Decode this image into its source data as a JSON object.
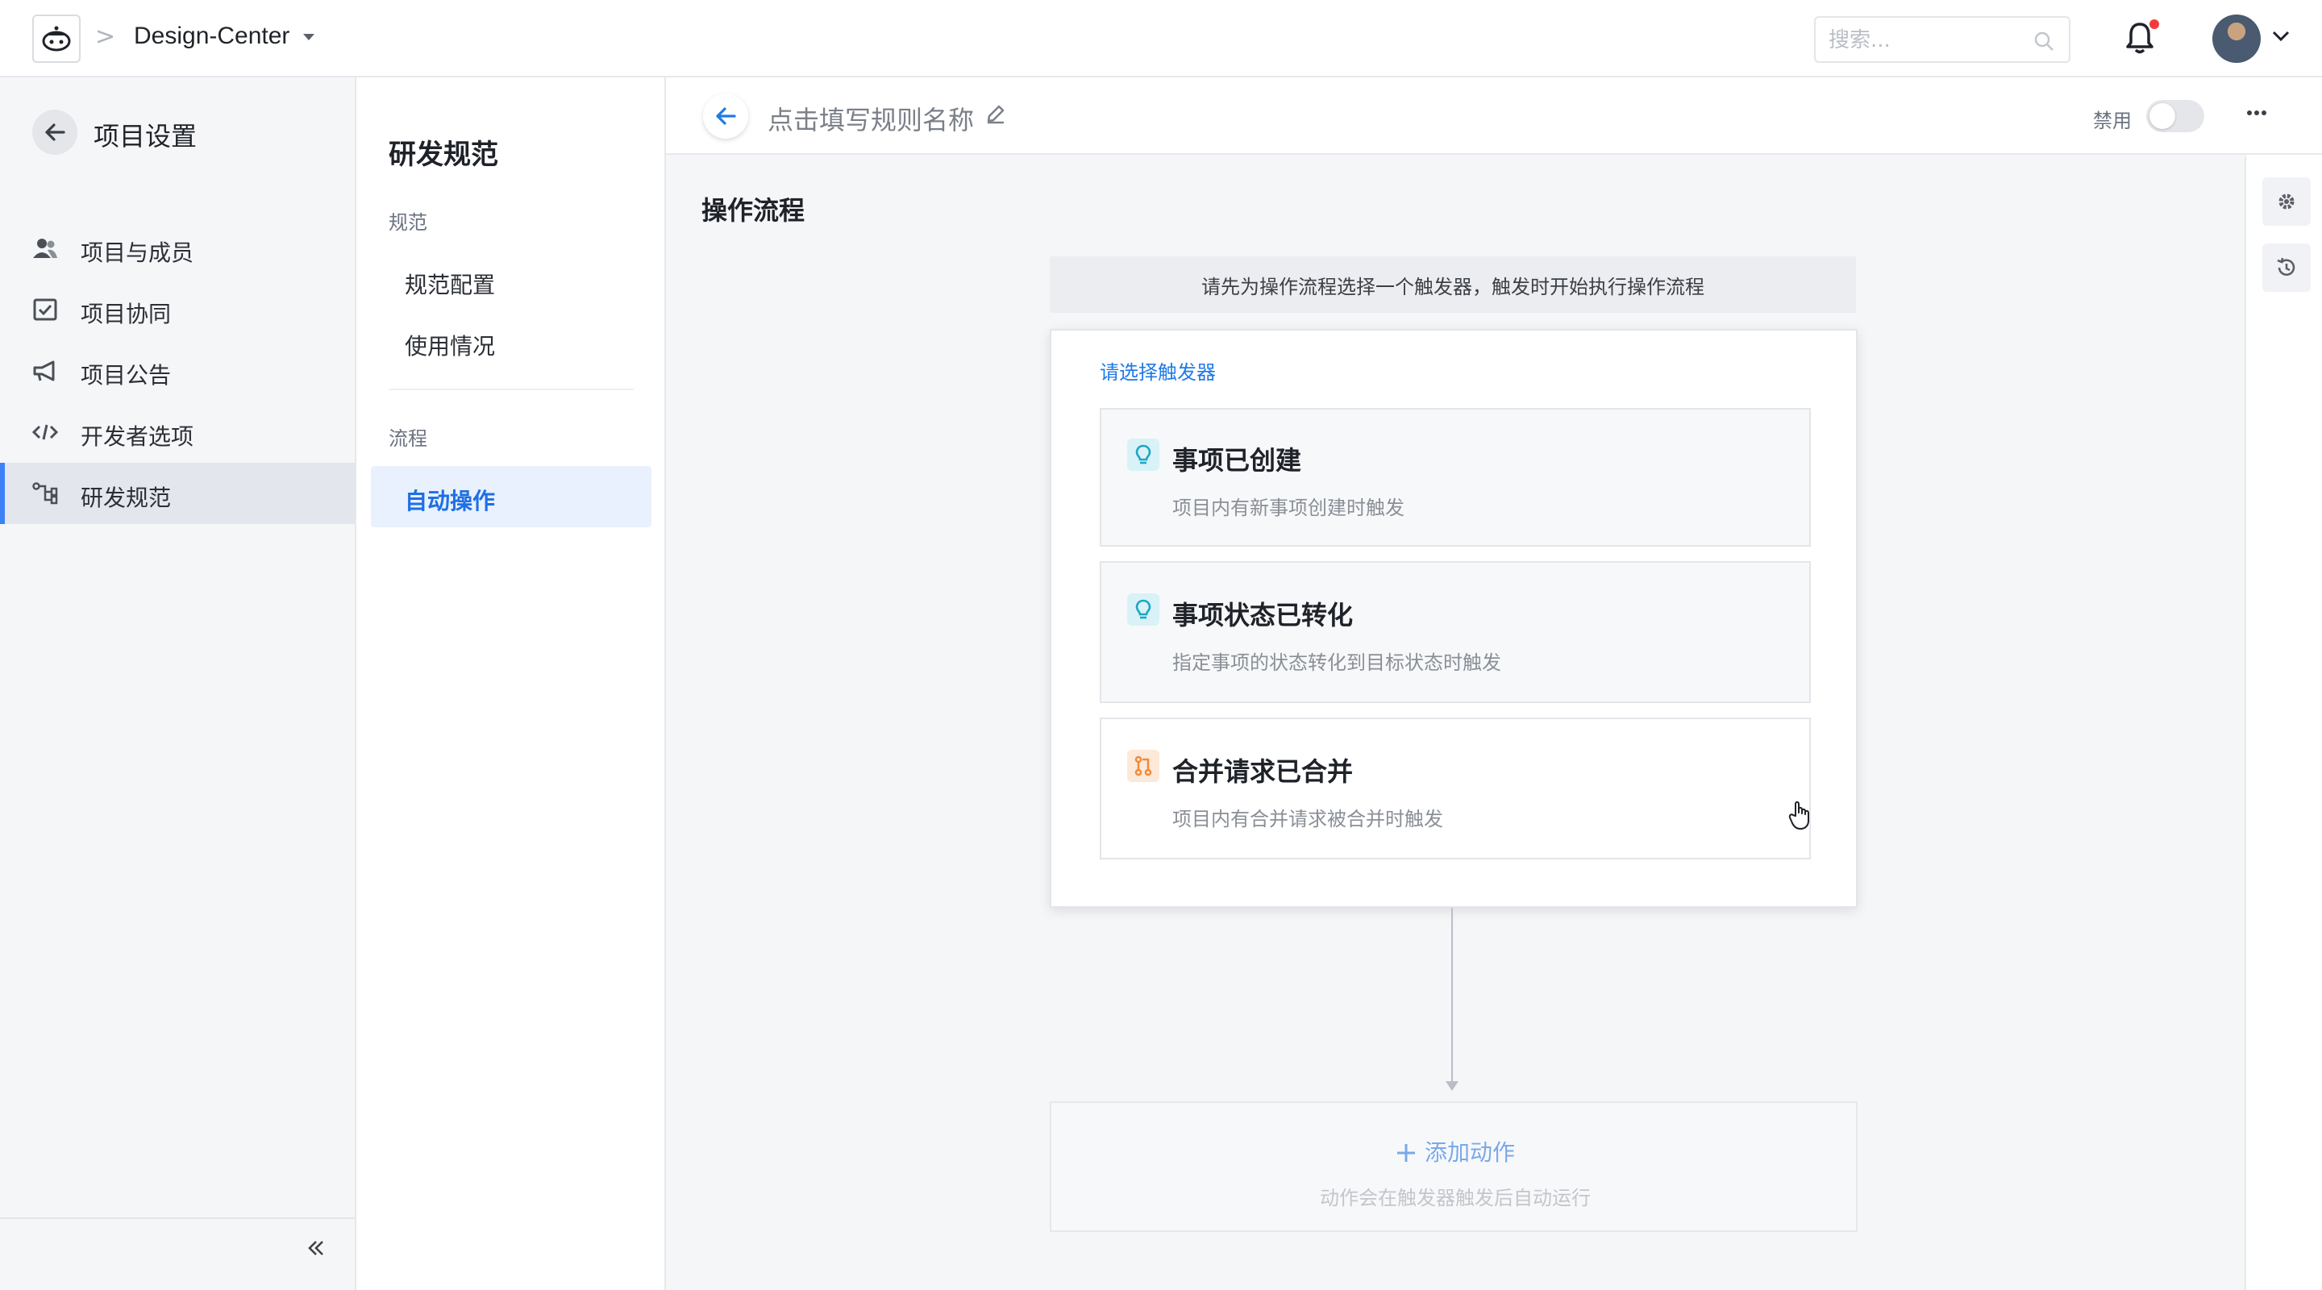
{
  "topbar": {
    "project_name": "Design-Center",
    "search_placeholder": "搜索...",
    "has_notification": true
  },
  "sidebar": {
    "title": "项目设置",
    "items": [
      {
        "label": "项目与成员",
        "icon": "members-icon",
        "active": false
      },
      {
        "label": "项目协同",
        "icon": "checkbox-icon",
        "active": false
      },
      {
        "label": "项目公告",
        "icon": "megaphone-icon",
        "active": false
      },
      {
        "label": "开发者选项",
        "icon": "code-icon",
        "active": false
      },
      {
        "label": "研发规范",
        "icon": "flow-icon",
        "active": true
      }
    ]
  },
  "panel": {
    "title": "研发规范",
    "section_spec": "规范",
    "spec_items": [
      "规范配置",
      "使用情况"
    ],
    "section_flow": "流程",
    "flow_items": [
      "自动操作"
    ]
  },
  "header": {
    "rule_name_placeholder": "点击填写规则名称",
    "toggle_label": "禁用",
    "toggle_on": false
  },
  "main": {
    "section_title": "操作流程",
    "hint": "请先为操作流程选择一个触发器，触发时开始执行操作流程",
    "trigger_label": "请选择触发器",
    "triggers": [
      {
        "title": "事项已创建",
        "desc": "项目内有新事项创建时触发",
        "icon": "bulb-icon"
      },
      {
        "title": "事项状态已转化",
        "desc": "指定事项的状态转化到目标状态时触发",
        "icon": "bulb-icon"
      },
      {
        "title": "合并请求已合并",
        "desc": "项目内有合并请求被合并时触发",
        "icon": "merge-icon"
      }
    ],
    "add_action_label": "添加动作",
    "add_action_desc": "动作会在触发器触发后自动运行"
  },
  "colors": {
    "accent": "#1f7ae8",
    "active_bg": "#e8f1fd",
    "bulb": "#1aa7c4",
    "merge": "#f08a3a"
  }
}
